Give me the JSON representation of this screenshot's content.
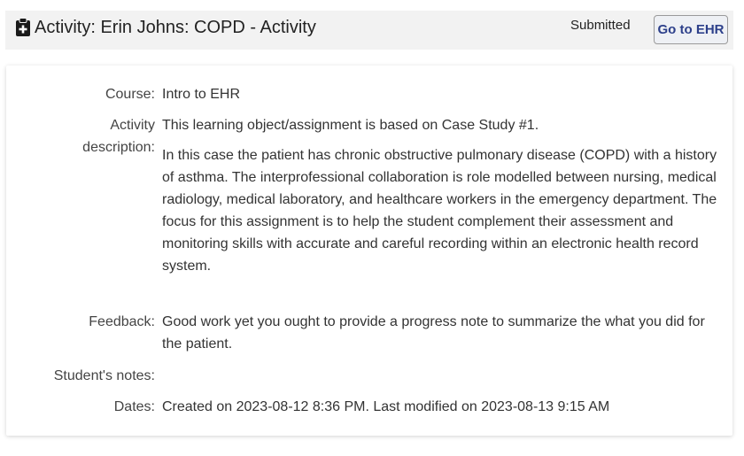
{
  "header": {
    "icon": "clipboard-plus-icon",
    "title": "Activity: Erin Johns: COPD - Activity",
    "status": "Submitted",
    "ehr_button": "Go to EHR"
  },
  "details": {
    "course": {
      "label": "Course:",
      "value": "Intro to EHR"
    },
    "activity_description": {
      "label_line1": "Activity",
      "label_line2": "description:",
      "paragraph1": "This learning object/assignment is based on Case Study #1.",
      "paragraph2": "In this case the patient has chronic obstructive pulmonary disease (COPD) with a history of asthma. The interprofessional collaboration is role modelled between nursing, medical radiology, medical laboratory, and healthcare workers in the emergency department. The focus for this assignment is to help the student complement their assessment and monitoring skills with accurate and careful recording within an electronic health record system."
    },
    "feedback": {
      "label": "Feedback:",
      "value": "Good work yet you ought to provide a progress note to summarize the what you did for the patient."
    },
    "student_notes": {
      "label": "Student's notes:",
      "value": ""
    },
    "dates": {
      "label": "Dates:",
      "value": "Created on 2023-08-12 8:36 PM. Last modified on 2023-08-13 9:15 AM"
    }
  },
  "colors": {
    "header_bg": "#f2f2f2",
    "button_text": "#2c3f8a",
    "label_text": "#444444"
  }
}
